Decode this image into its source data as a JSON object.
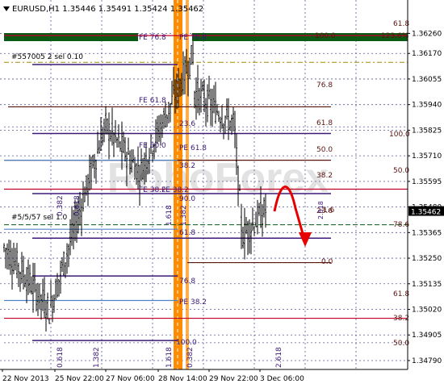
{
  "header": {
    "symbol": "EURUSD,H1",
    "ohlc": "1.35446 1.35491 1.35424 1.35462"
  },
  "current_price": "1.35462",
  "colors": {
    "bg": "#ffffff",
    "grid": "#5a5a96",
    "candle": "#000000",
    "orange": "#ff8c00",
    "red": "#c0002a",
    "purple": "#3c1a78",
    "brown": "#5a1410",
    "blue": "#5082c8",
    "olive": "#a08c00",
    "green": "#0a5a14",
    "arrow": "#e60000",
    "watermark": "#dcdcdc"
  },
  "watermark": "RoboForex",
  "price_axis": {
    "min": 1.3475,
    "max": 1.3641,
    "labels": [
      "1.36260",
      "1.36170",
      "1.36055",
      "1.35940",
      "1.35825",
      "1.35710",
      "1.35595",
      "1.35480",
      "1.35365",
      "1.35250",
      "1.35135",
      "1.35020",
      "1.34905",
      "1.34790"
    ]
  },
  "time_axis": {
    "labels": [
      "22 Nov 2013",
      "25 Nov 22:00",
      "27 Nov 06:00",
      "28 Nov 14:00",
      "29 Nov 22:00",
      "3 Dec 06:00"
    ]
  },
  "annotations": {
    "fib_right": [
      "61.8",
      "100.0",
      "123.6%",
      "76.8",
      "61.8",
      "100.0",
      "50.0",
      "38.2",
      "50.0",
      "23.6",
      "78.6",
      "0.0",
      "61.8",
      "38.2",
      "50.0"
    ],
    "fib_left": [
      "FE 76.8",
      "PE 76.8",
      "FE 61.8",
      "23.6",
      "FE 50.0",
      "PE 61.8",
      "38.2",
      "FE 38.2",
      "90.0",
      "FE 38.2",
      "61.8",
      "76.8",
      "PE 38.2",
      "100.0"
    ],
    "time_fib": [
      "0.382",
      "0.618",
      "1.382",
      "1.618",
      "1.382",
      "1.618",
      "0.382",
      "0.618",
      "2.618"
    ],
    "side_labels": [
      "#557005 2 sel 0.10",
      "#5/5/57 sel 1.0",
      "2.618",
      "1.6"
    ]
  }
}
